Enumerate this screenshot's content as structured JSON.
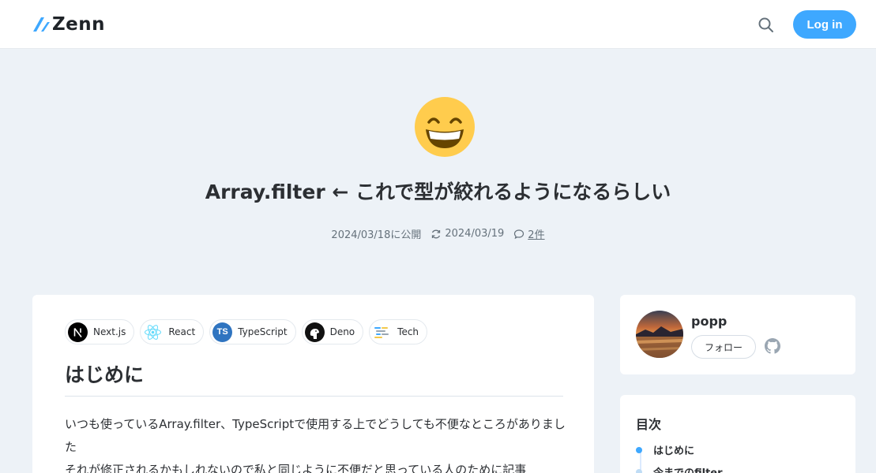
{
  "header": {
    "logo_text": "Zenn",
    "login_label": "Log in"
  },
  "article": {
    "emoji": "grinning-face-with-smiling-eyes",
    "title": "Array.filter ← これで型が絞れるようになるらしい",
    "published": "2024/03/18に公開",
    "updated": "2024/03/19",
    "comments": "2件",
    "topics": [
      {
        "label": "Next.js",
        "icon": "nextjs-icon"
      },
      {
        "label": "React",
        "icon": "react-icon"
      },
      {
        "label": "TypeScript",
        "icon": "typescript-icon",
        "icon_text": "TS"
      },
      {
        "label": "Deno",
        "icon": "deno-icon"
      },
      {
        "label": "Tech",
        "icon": "tech-icon"
      }
    ],
    "heading": "はじめに",
    "paragraphs": [
      "いつも使っているArray.filter、TypeScriptで使用する上でどうしても不便なところがありました",
      "それが修正されるかもしれないので私と同じように不便だと思っている人のために記事"
    ]
  },
  "author": {
    "name": "popp",
    "follow_label": "フォロー"
  },
  "toc": {
    "title": "目次",
    "items": [
      "はじめに",
      "今までのfilter"
    ]
  },
  "colors": {
    "accent": "#3ea8ff",
    "background": "#edf2f7"
  }
}
